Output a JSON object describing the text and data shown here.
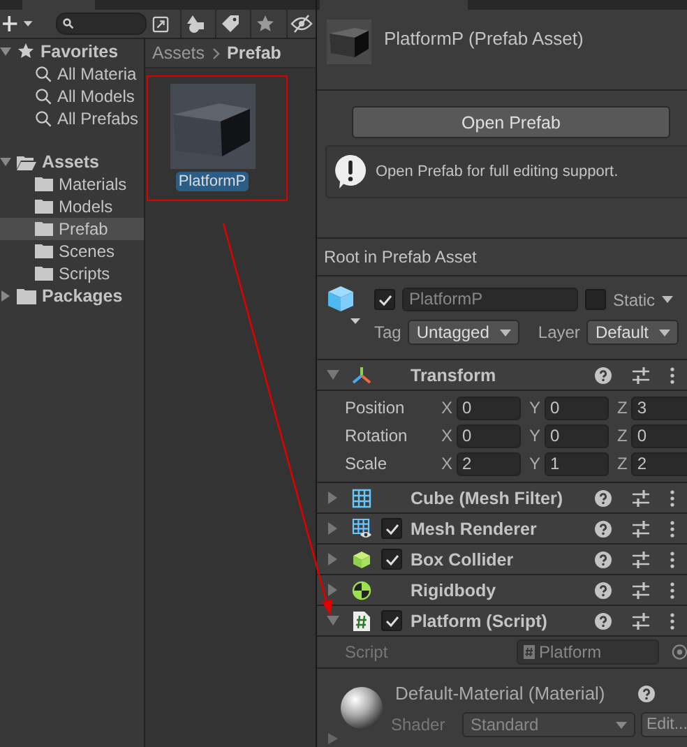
{
  "tree": [
    {
      "label": "Favorites",
      "kind": "favorites",
      "expanded": true,
      "selected": false,
      "children": [
        {
          "label": "All Materia",
          "kind": "search",
          "selected": false
        },
        {
          "label": "All Models",
          "kind": "search",
          "selected": false
        },
        {
          "label": "All Prefabs",
          "kind": "search",
          "selected": false
        }
      ]
    },
    {
      "label": "Assets",
      "kind": "folder",
      "expanded": true,
      "selected": false,
      "children": [
        {
          "label": "Materials",
          "kind": "folder",
          "selected": false
        },
        {
          "label": "Models",
          "kind": "folder",
          "selected": false
        },
        {
          "label": "Prefab",
          "kind": "folder",
          "selected": true
        },
        {
          "label": "Scenes",
          "kind": "folder",
          "selected": false
        },
        {
          "label": "Scripts",
          "kind": "folder",
          "selected": false
        }
      ]
    },
    {
      "label": "Packages",
      "kind": "folder",
      "expanded": false,
      "selected": false
    }
  ],
  "breadcrumb": [
    "Assets",
    "Prefab"
  ],
  "assets": [
    {
      "name": "PlatformP",
      "selected": true
    }
  ],
  "inspector": {
    "title": "PlatformP (Prefab Asset)",
    "open_button": "Open Prefab",
    "info": "Open Prefab for full editing support.",
    "root_label": "Root in Prefab Asset",
    "object": {
      "active": true,
      "name": "PlatformP",
      "static": false,
      "static_label": "Static",
      "tag_label": "Tag",
      "tag": "Untagged",
      "layer_label": "Layer",
      "layer": "Default"
    },
    "components": [
      {
        "name": "Transform",
        "kind": "transform",
        "expanded": true,
        "rows": [
          {
            "label": "Position",
            "values": [
              {
                "axis": "X",
                "value": "0"
              },
              {
                "axis": "Y",
                "value": "0"
              },
              {
                "axis": "Z",
                "value": "3"
              }
            ]
          },
          {
            "label": "Rotation",
            "values": [
              {
                "axis": "X",
                "value": "0"
              },
              {
                "axis": "Y",
                "value": "0"
              },
              {
                "axis": "Z",
                "value": "0"
              }
            ]
          },
          {
            "label": "Scale",
            "values": [
              {
                "axis": "X",
                "value": "2"
              },
              {
                "axis": "Y",
                "value": "1"
              },
              {
                "axis": "Z",
                "value": "2"
              }
            ]
          }
        ]
      },
      {
        "name": "Cube (Mesh Filter)",
        "kind": "mesh-filter",
        "expanded": false
      },
      {
        "name": "Mesh Renderer",
        "kind": "mesh-renderer",
        "expanded": false,
        "enabled": true
      },
      {
        "name": "Box Collider",
        "kind": "box-collider",
        "expanded": false,
        "enabled": true
      },
      {
        "name": "Rigidbody",
        "kind": "rigidbody",
        "expanded": false
      },
      {
        "name": "Platform (Script)",
        "kind": "script",
        "expanded": true,
        "enabled": true,
        "script_label": "Script",
        "script": "Platform"
      }
    ],
    "material": {
      "name": "Default-Material (Material)",
      "shader_label": "Shader",
      "shader": "Standard",
      "edit": "Edit..."
    }
  }
}
